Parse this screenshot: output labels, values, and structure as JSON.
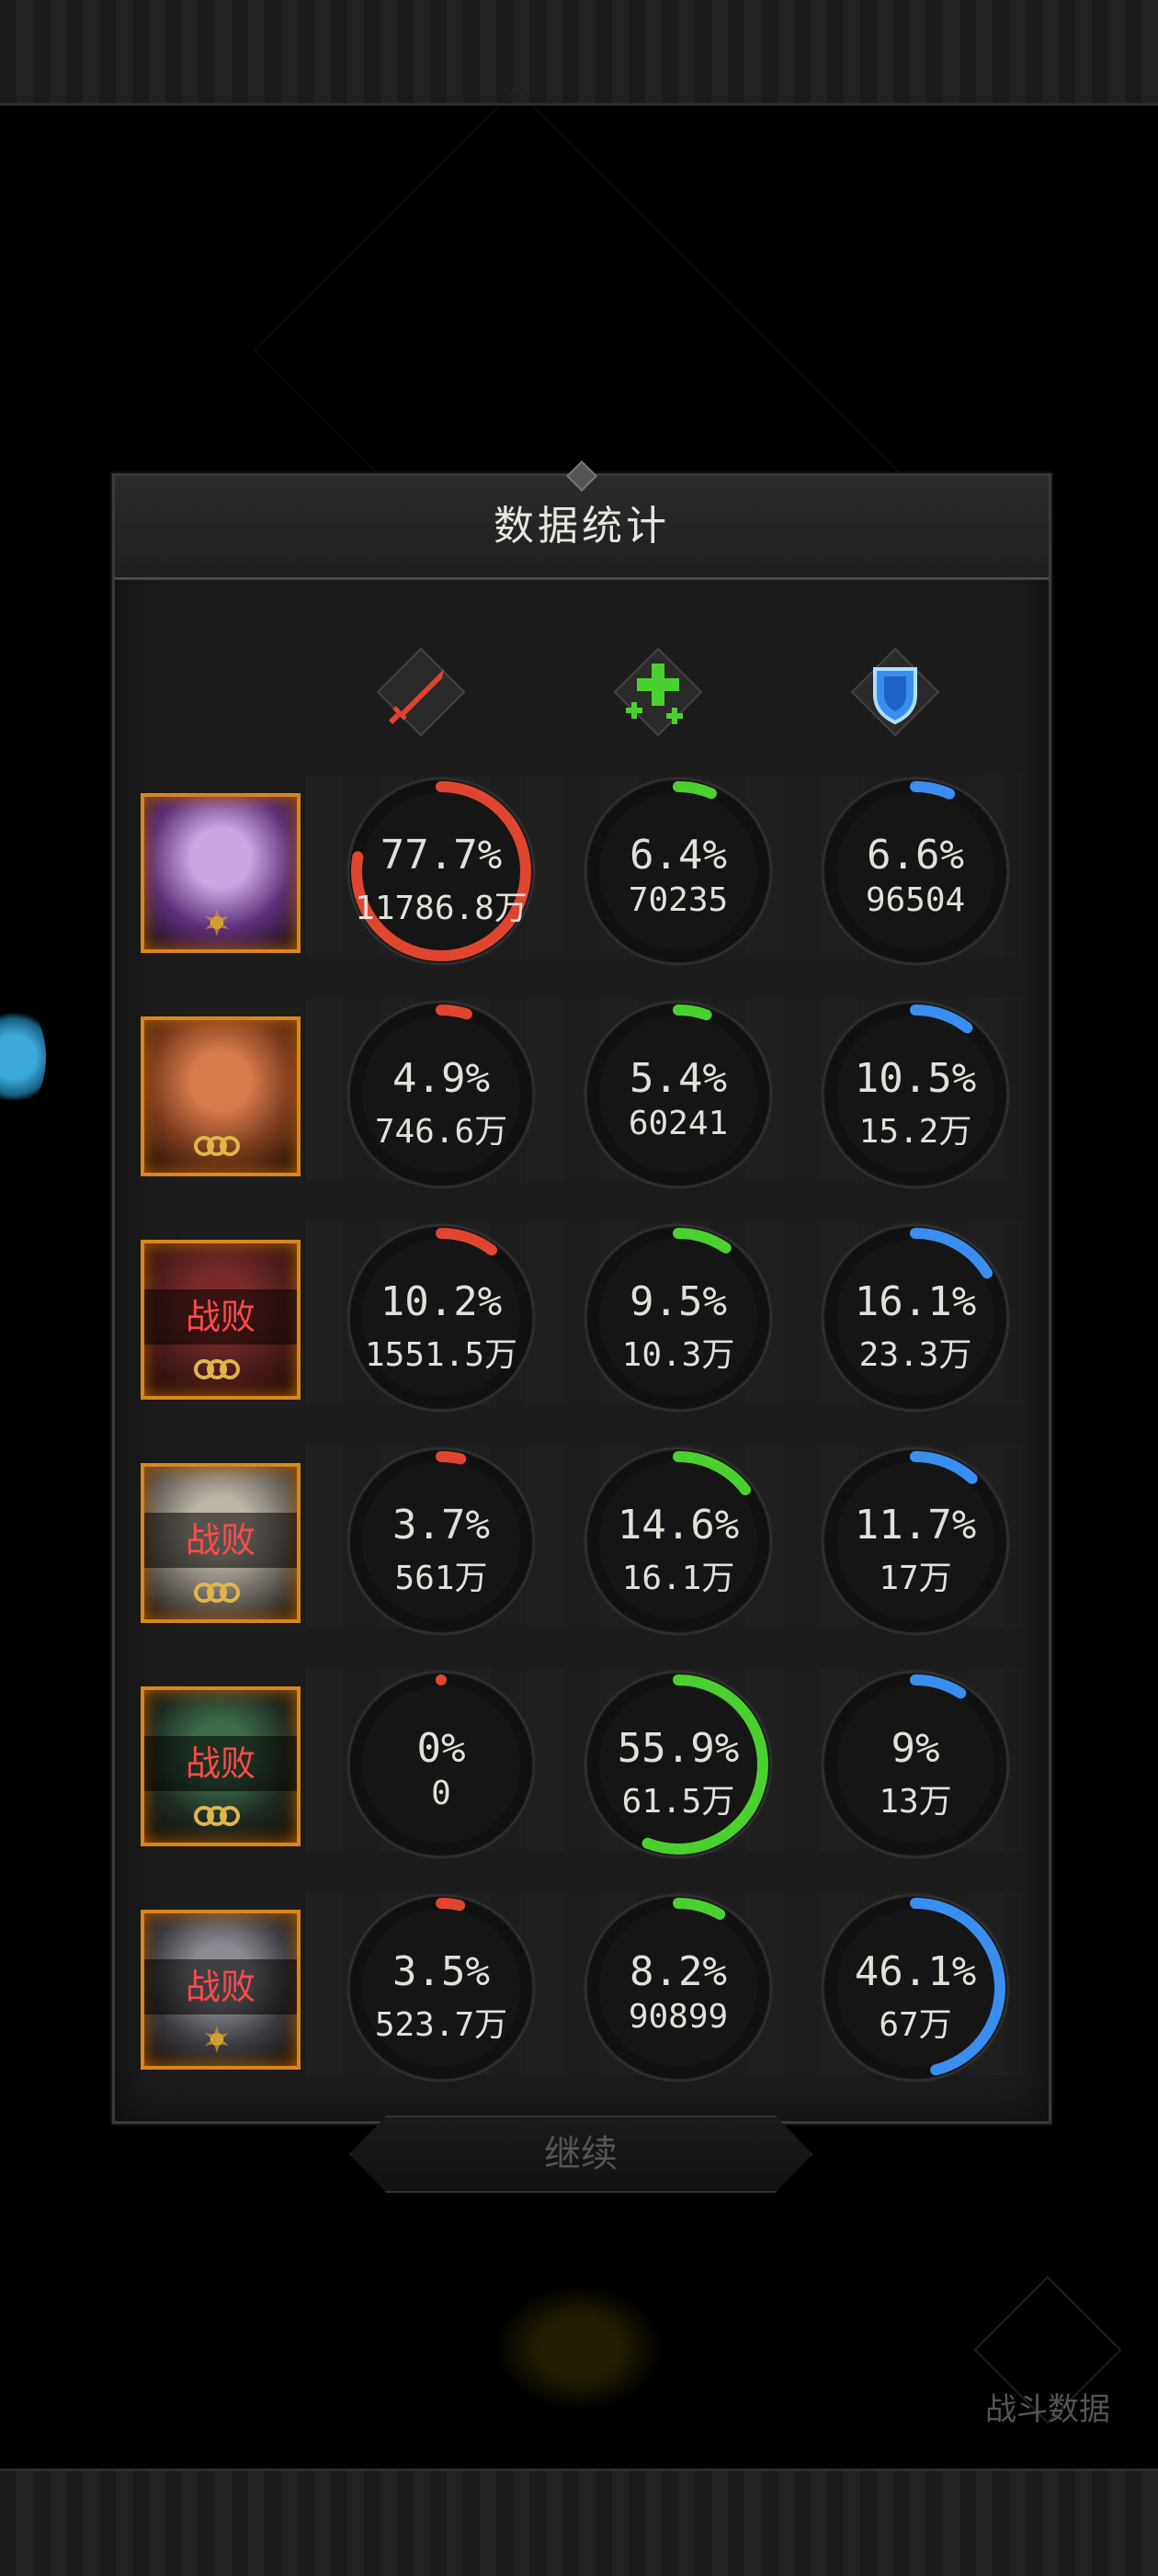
{
  "panel": {
    "title": "数据统计"
  },
  "columns": [
    {
      "icon": "sword-icon",
      "color": "#e0452f"
    },
    {
      "icon": "heal-cross-icon",
      "color": "#4bd12f"
    },
    {
      "icon": "shield-icon",
      "color": "#3a8ef0"
    }
  ],
  "rows": [
    {
      "portrait_icon": "hero-portrait-1",
      "defeated": "",
      "rank": "sun-badge",
      "damage": {
        "pct": "77.7%",
        "value": "11786.8万",
        "fraction": 0.777
      },
      "heal": {
        "pct": "6.4%",
        "value": "70235",
        "fraction": 0.064
      },
      "tank": {
        "pct": "6.6%",
        "value": "96504",
        "fraction": 0.066
      }
    },
    {
      "portrait_icon": "hero-portrait-2",
      "defeated": "",
      "rank": "triple-ring",
      "damage": {
        "pct": "4.9%",
        "value": "746.6万",
        "fraction": 0.049
      },
      "heal": {
        "pct": "5.4%",
        "value": "60241",
        "fraction": 0.054
      },
      "tank": {
        "pct": "10.5%",
        "value": "15.2万",
        "fraction": 0.105
      }
    },
    {
      "portrait_icon": "hero-portrait-3",
      "defeated": "战败",
      "rank": "triple-ring",
      "damage": {
        "pct": "10.2%",
        "value": "1551.5万",
        "fraction": 0.102
      },
      "heal": {
        "pct": "9.5%",
        "value": "10.3万",
        "fraction": 0.095
      },
      "tank": {
        "pct": "16.1%",
        "value": "23.3万",
        "fraction": 0.161
      }
    },
    {
      "portrait_icon": "hero-portrait-4",
      "defeated": "战败",
      "rank": "triple-ring",
      "damage": {
        "pct": "3.7%",
        "value": "561万",
        "fraction": 0.037
      },
      "heal": {
        "pct": "14.6%",
        "value": "16.1万",
        "fraction": 0.146
      },
      "tank": {
        "pct": "11.7%",
        "value": "17万",
        "fraction": 0.117
      }
    },
    {
      "portrait_icon": "hero-portrait-5",
      "defeated": "战败",
      "rank": "triple-ring",
      "damage": {
        "pct": "0%",
        "value": "0",
        "fraction": 0.0
      },
      "heal": {
        "pct": "55.9%",
        "value": "61.5万",
        "fraction": 0.559
      },
      "tank": {
        "pct": "9%",
        "value": "13万",
        "fraction": 0.09
      }
    },
    {
      "portrait_icon": "hero-portrait-6",
      "defeated": "战败",
      "rank": "sun-badge",
      "damage": {
        "pct": "3.5%",
        "value": "523.7万",
        "fraction": 0.035
      },
      "heal": {
        "pct": "8.2%",
        "value": "90899",
        "fraction": 0.082
      },
      "tank": {
        "pct": "46.1%",
        "value": "67万",
        "fraction": 0.461
      }
    }
  ],
  "continue_label": "继续",
  "battle_data_label": "战斗数据"
}
